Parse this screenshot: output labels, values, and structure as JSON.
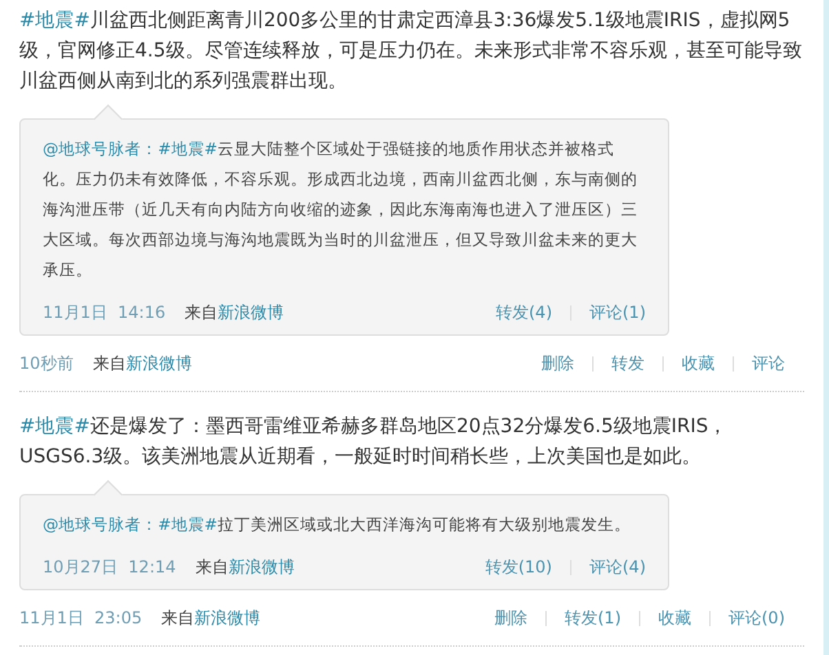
{
  "posts": [
    {
      "topic": "#地震#",
      "text": "川盆西北侧距离青川200多公里的甘肃定西漳县3:36爆发5.1级地震IRIS，虚拟网5级，官网修正4.5级。尽管连续释放，可是压力仍在。未来形式非常不容乐观，甚至可能导致川盆西侧从南到北的系列强震群出现。",
      "retweet": {
        "author": "@地球号脉者：",
        "topic": "#地震#",
        "text": "云显大陆整个区域处于强链接的地质作用状态并被格式化。压力仍未有效降低，不容乐观。形成西北边境，西南川盆西北侧，东与南侧的海沟泄压带（近几天有向内陆方向收缩的迹象，因此东海南海也进入了泄压区）三大区域。每次西部边境与海沟地震既为当时的川盆泄压，但又导致川盆未来的更大承压。",
        "time": "11月1日  14:16",
        "source_label": "来自",
        "source": "新浪微博",
        "actions": [
          "转发(4)",
          "评论(1)"
        ]
      },
      "time": "10秒前",
      "source_label": "来自",
      "source": "新浪微博",
      "actions": [
        "删除",
        "转发",
        "收藏",
        "评论"
      ]
    },
    {
      "topic": "#地震#",
      "text": "还是爆发了：墨西哥雷维亚希赫多群岛地区20点32分爆发6.5级地震IRIS，USGS6.3级。该美洲地震从近期看，一般延时时间稍长些，上次美国也是如此。",
      "retweet": {
        "author": "@地球号脉者：",
        "topic": "#地震#",
        "text": "拉丁美洲区域或北大西洋海沟可能将有大级别地震发生。",
        "time": "10月27日  12:14",
        "source_label": "来自",
        "source": "新浪微博",
        "actions": [
          "转发(10)",
          "评论(4)"
        ]
      },
      "time": "11月1日  23:05",
      "source_label": "来自",
      "source": "新浪微博",
      "actions": [
        "删除",
        "转发(1)",
        "收藏",
        "评论(0)"
      ]
    }
  ]
}
